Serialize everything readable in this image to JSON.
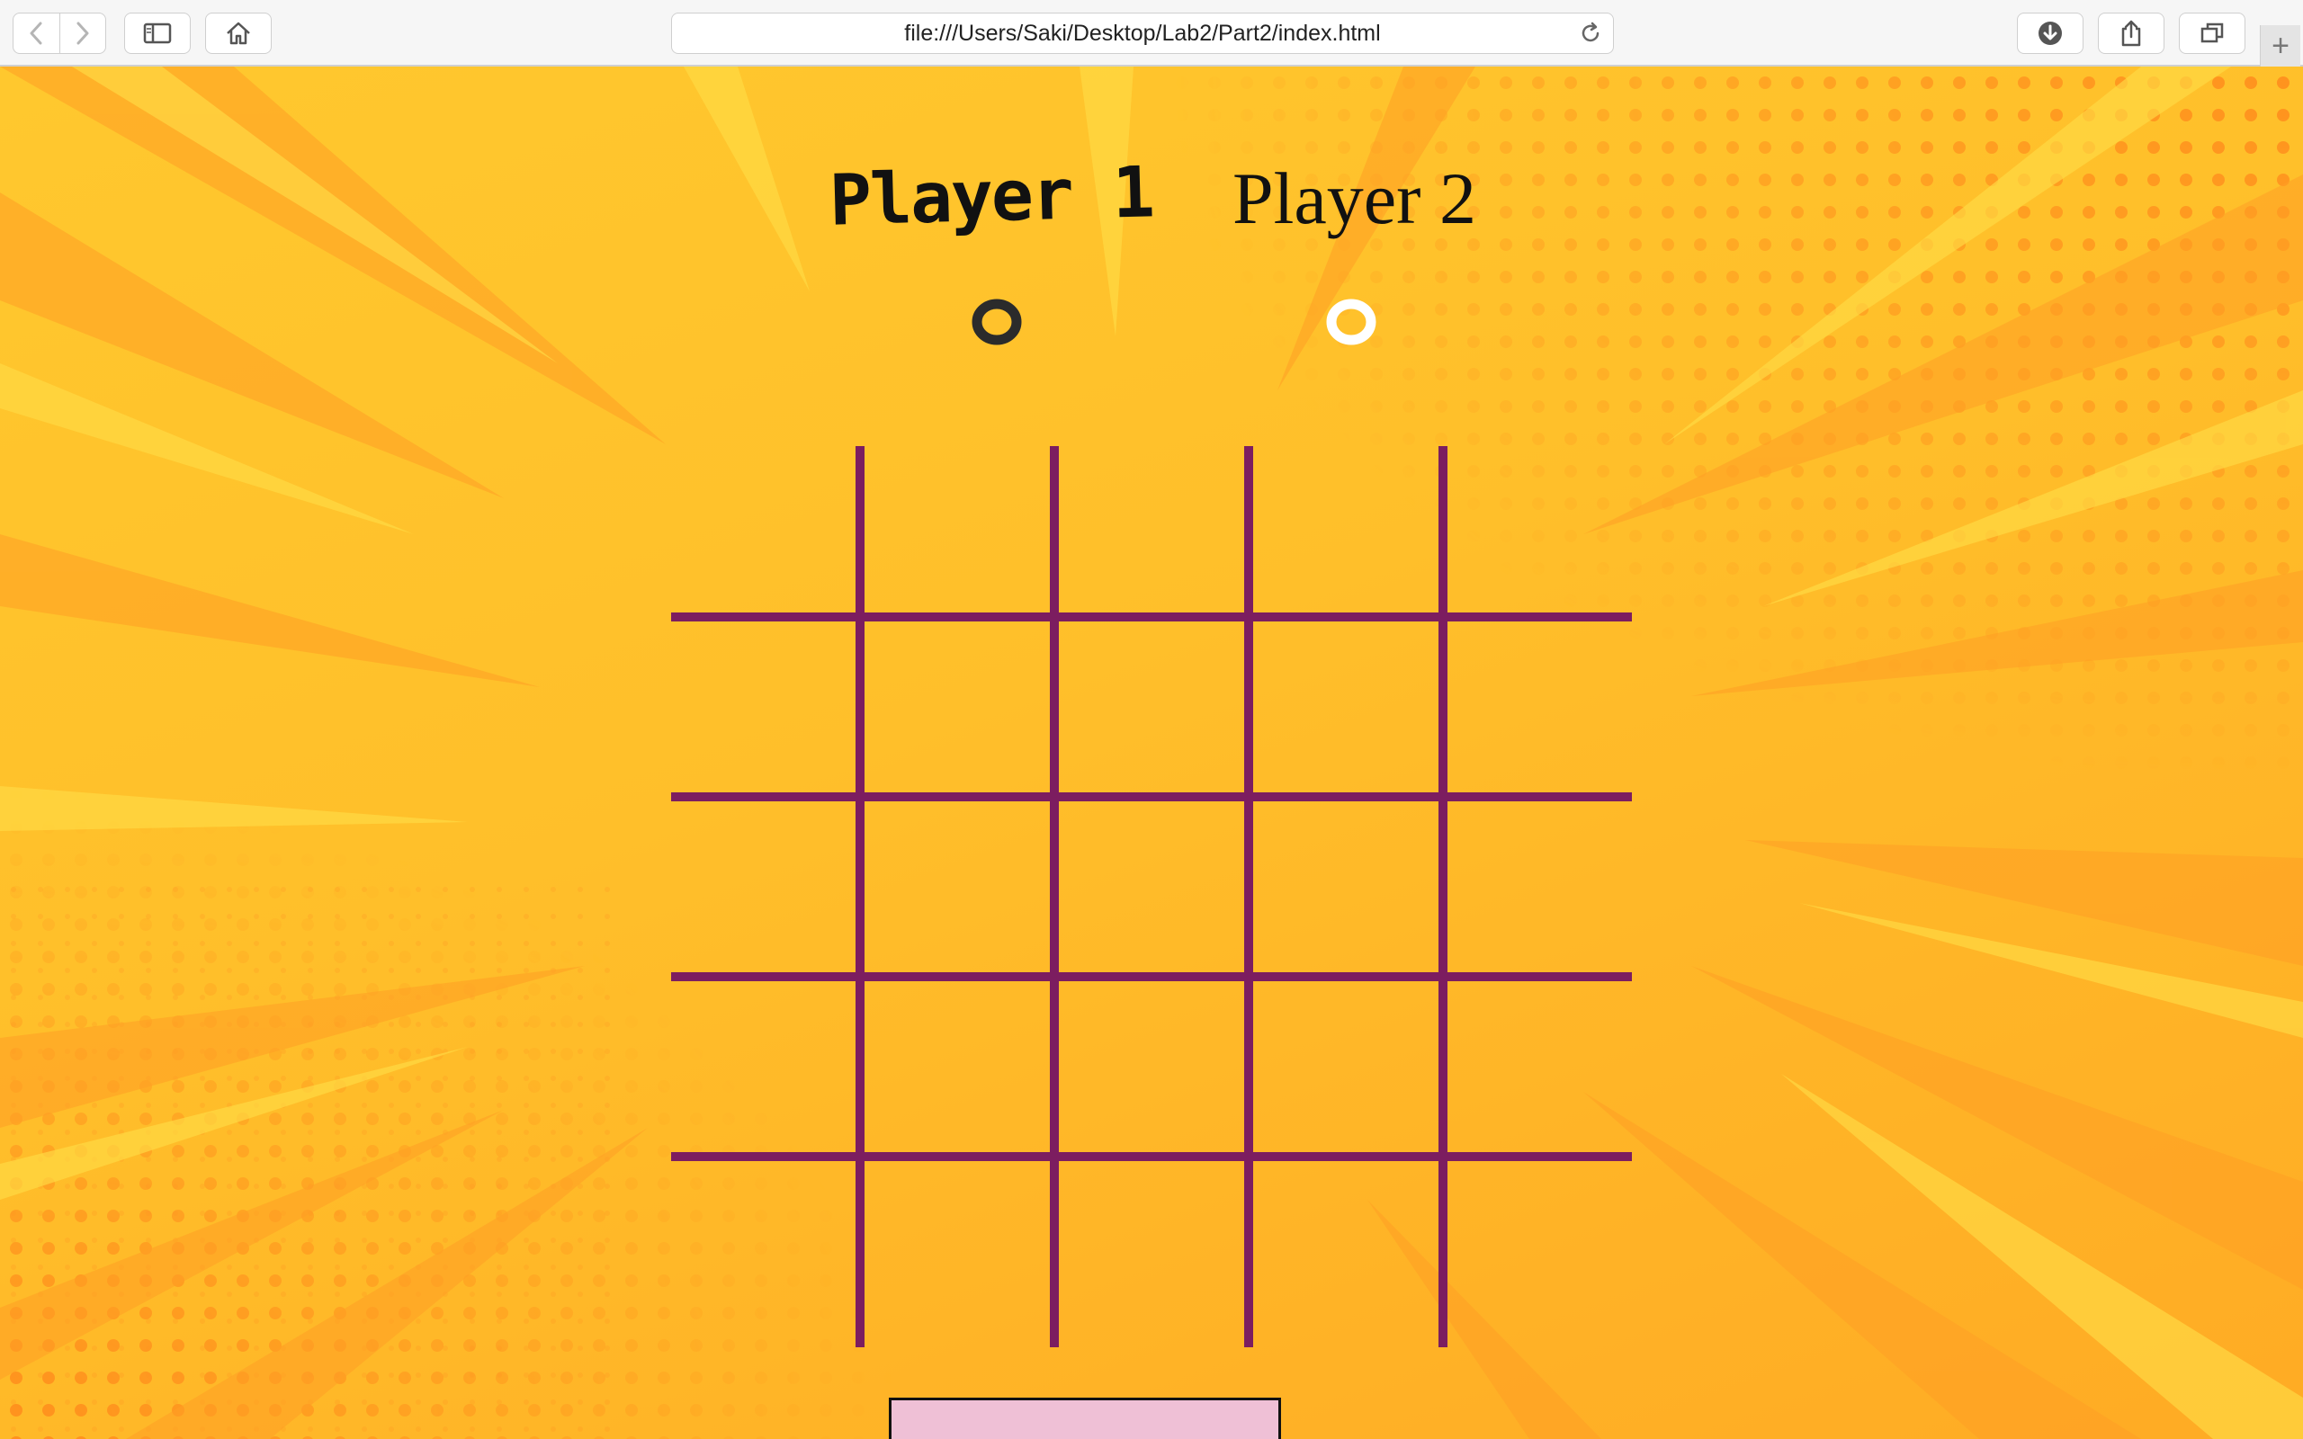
{
  "browser": {
    "address_url": "file:///Users/Saki/Desktop/Lab2/Part2/index.html",
    "new_tab_symbol": "+",
    "toolbar_icons": [
      "back-icon",
      "forward-icon",
      "sidebar-icon",
      "home-icon",
      "reload-icon",
      "download-icon",
      "share-icon",
      "tabs-overview-icon",
      "new-tab-icon"
    ]
  },
  "game": {
    "player1": {
      "label": "Player 1",
      "marker": "O",
      "marker_color": "#2b2b2b"
    },
    "player2": {
      "label": "Player 2",
      "marker": "O",
      "marker_color": "#ffffff"
    },
    "board": {
      "rows": 5,
      "cols": 5,
      "line_color": "#7c1d60"
    },
    "reset_button_label": ""
  },
  "colors": {
    "background_top": "#ffc82e",
    "background_bottom": "#ffab24",
    "ray": "#ff9a22",
    "dots": "#ff8a1c",
    "reset_button": "#efc0d6"
  }
}
